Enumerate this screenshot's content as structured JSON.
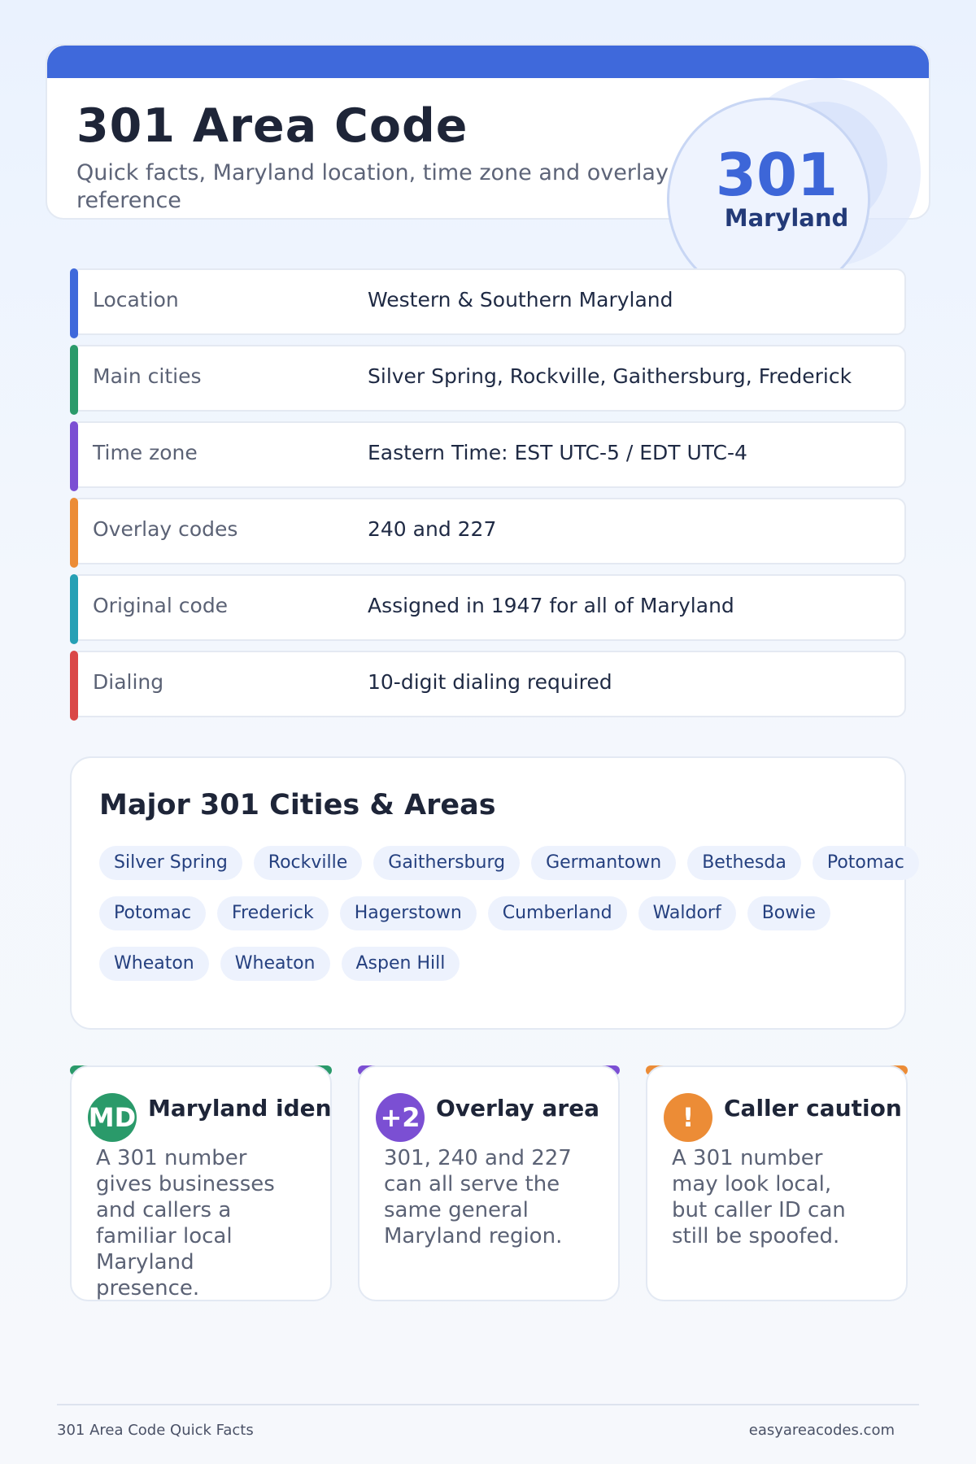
{
  "header": {
    "title": "301 Area Code",
    "subtitle": "Quick facts, Maryland location, time zone and overlay reference"
  },
  "badge": {
    "code": "301",
    "state": "Maryland"
  },
  "facts": [
    {
      "label": "Location",
      "value": "Western & Southern Maryland",
      "color": "#3f69db"
    },
    {
      "label": "Main cities",
      "value": "Silver Spring, Rockville, Gaithersburg, Frederick",
      "color": "#2a9a6a"
    },
    {
      "label": "Time zone",
      "value": "Eastern Time: EST UTC-5 / EDT UTC-4",
      "color": "#7b4fd3"
    },
    {
      "label": "Overlay codes",
      "value": "240 and 227",
      "color": "#ec8c36"
    },
    {
      "label": "Original code",
      "value": "Assigned in 1947 for all of Maryland",
      "color": "#26a0b5"
    },
    {
      "label": "Dialing",
      "value": "10-digit dialing required",
      "color": "#da4747"
    }
  ],
  "cities": {
    "title": "Major 301 Cities & Areas",
    "chips": [
      "Silver Spring",
      "Rockville",
      "Gaithersburg",
      "Germantown",
      "Bethesda",
      "Potomac",
      "Potomac",
      "Frederick",
      "Hagerstown",
      "Cumberland",
      "Waldorf",
      "Bowie",
      "Wheaton",
      "Wheaton",
      "Aspen Hill"
    ]
  },
  "cards": [
    {
      "icon": "MD",
      "icon_name": "maryland-initials-icon",
      "title": "Maryland identity",
      "text": "A 301 number gives businesses and callers a familiar local Maryland presence.",
      "color": "#2a9a6a"
    },
    {
      "icon": "+2",
      "icon_name": "plus-two-icon",
      "title": "Overlay area",
      "text": "301, 240 and 227 can all serve the same general Maryland region.",
      "color": "#7b4fd3"
    },
    {
      "icon": "!",
      "icon_name": "warning-icon",
      "title": "Caller caution",
      "text": "A 301 number may look local, but caller ID can still be spoofed.",
      "color": "#ec8c36"
    }
  ],
  "footer": {
    "left": "301 Area Code Quick Facts",
    "right": "easyareacodes.com"
  }
}
